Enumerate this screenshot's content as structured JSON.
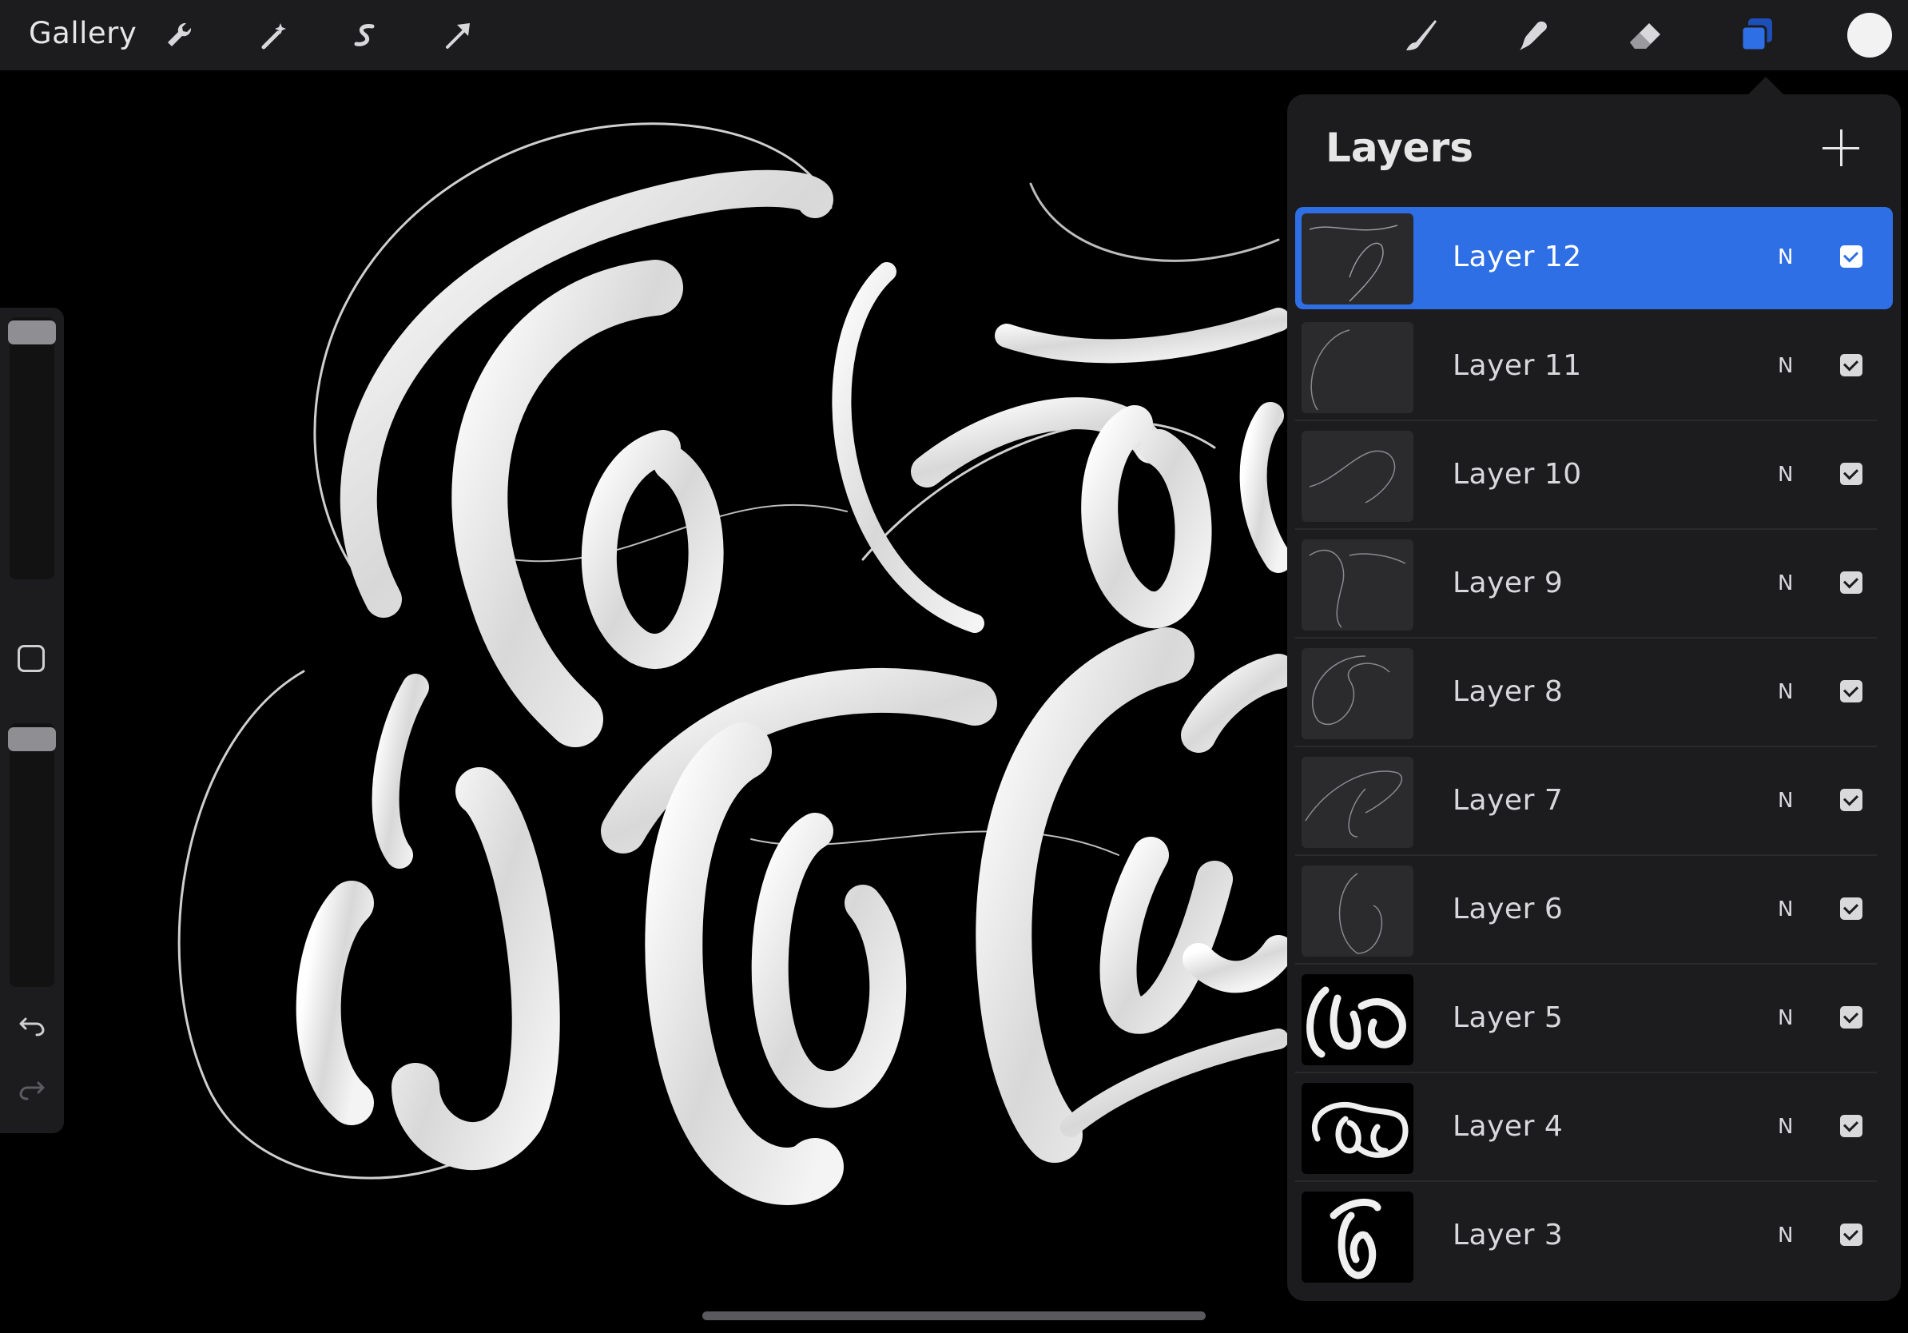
{
  "toolbar": {
    "gallery_label": "Gallery",
    "left_icons": [
      "wrench-icon",
      "magic-wand-icon",
      "selection-s-icon",
      "arrow-transform-icon"
    ],
    "right_icons": [
      "brush-icon",
      "smudge-icon",
      "eraser-icon",
      "layers-icon",
      "color-circle"
    ],
    "accent": "#2f6fe6",
    "current_color": "#f2f2f2"
  },
  "sidebar": {
    "brush_size_level": 0.0,
    "opacity_level": 0.0,
    "icons": [
      "modify-square",
      "undo-arrow",
      "redo-arrow"
    ]
  },
  "layers_panel": {
    "title": "Layers",
    "add_icon": "plus-icon",
    "layers": [
      {
        "name": "Layer 12",
        "blend": "N",
        "visible": true,
        "selected": true
      },
      {
        "name": "Layer 11",
        "blend": "N",
        "visible": true,
        "selected": false
      },
      {
        "name": "Layer 10",
        "blend": "N",
        "visible": true,
        "selected": false
      },
      {
        "name": "Layer 9",
        "blend": "N",
        "visible": true,
        "selected": false
      },
      {
        "name": "Layer 8",
        "blend": "N",
        "visible": true,
        "selected": false
      },
      {
        "name": "Layer 7",
        "blend": "N",
        "visible": true,
        "selected": false
      },
      {
        "name": "Layer 6",
        "blend": "N",
        "visible": true,
        "selected": false
      },
      {
        "name": "Layer 5",
        "blend": "N",
        "visible": true,
        "selected": false
      },
      {
        "name": "Layer 4",
        "blend": "N",
        "visible": true,
        "selected": false
      },
      {
        "name": "Layer 3",
        "blend": "N",
        "visible": true,
        "selected": false
      }
    ]
  }
}
